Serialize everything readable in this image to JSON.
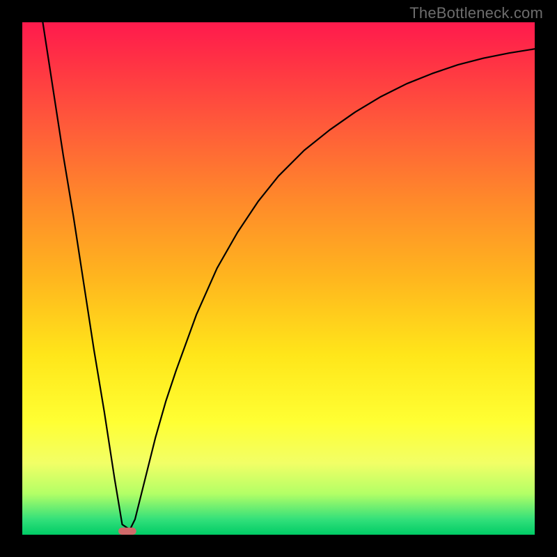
{
  "watermark": "TheBottleneck.com",
  "chart_data": {
    "type": "line",
    "title": "",
    "xlabel": "",
    "ylabel": "",
    "xlim": [
      0,
      100
    ],
    "ylim": [
      0,
      100
    ],
    "grid": false,
    "legend": false,
    "background_gradient": {
      "top": "#ff1a4d",
      "bottom": "#00cc66",
      "stops": [
        "red",
        "orange",
        "yellow",
        "green"
      ]
    },
    "series": [
      {
        "name": "bottleneck-curve",
        "color": "#000000",
        "x": [
          4,
          6,
          8,
          10,
          12,
          14,
          16,
          18,
          19.5,
          21,
          22,
          24,
          26,
          28,
          30,
          34,
          38,
          42,
          46,
          50,
          55,
          60,
          65,
          70,
          75,
          80,
          85,
          90,
          95,
          100
        ],
        "y": [
          100,
          87,
          74,
          62,
          49,
          36,
          24,
          11,
          2,
          1,
          3,
          11,
          19,
          26,
          32,
          43,
          52,
          59,
          65,
          70,
          75,
          79,
          82.5,
          85.5,
          88,
          90,
          91.7,
          93,
          94,
          94.8
        ]
      }
    ],
    "marker": {
      "name": "optimal-range-marker",
      "x": 20.5,
      "y": 0,
      "width": 3.5,
      "height": 1.4,
      "color": "#d06a6a",
      "shape": "rounded-rect"
    }
  }
}
